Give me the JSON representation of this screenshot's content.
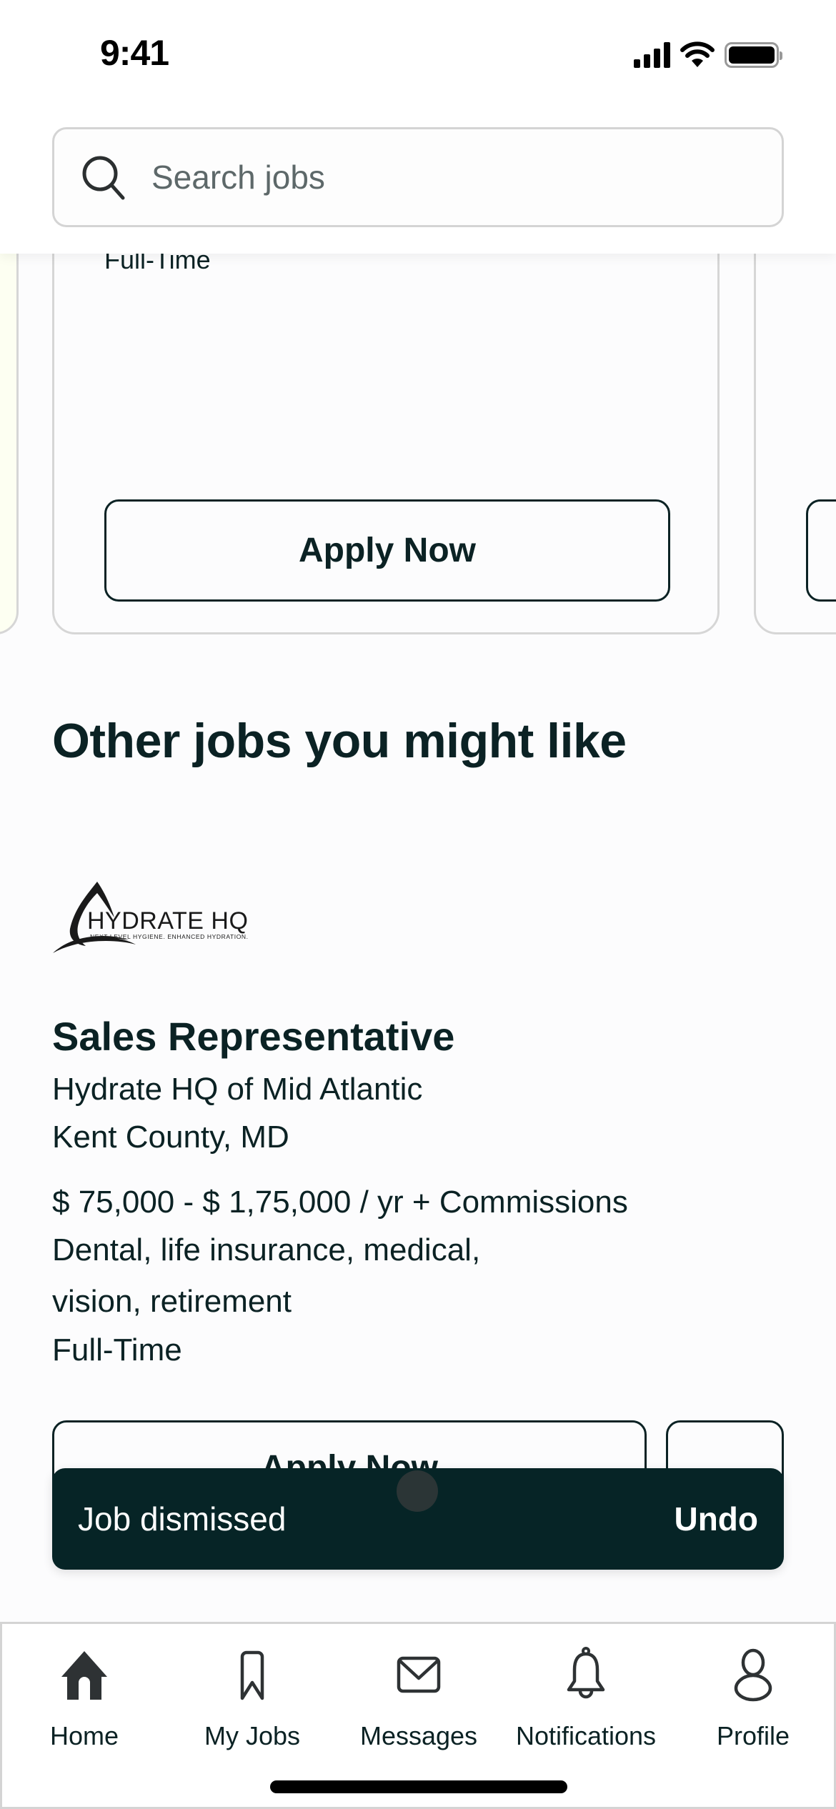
{
  "status_bar": {
    "time": "9:41"
  },
  "search": {
    "placeholder": "Search jobs"
  },
  "carousel": {
    "current_card": {
      "job_type": "Full-Time",
      "apply_label": "Apply Now"
    }
  },
  "section": {
    "title": "Other jobs you might like"
  },
  "job": {
    "company_logo_text": "HYDRATE HQ",
    "company_logo_tagline": "NEXT LEVEL HYGIENE. ENHANCED HYDRATION.",
    "title": "Sales Representative",
    "company": "Hydrate HQ of Mid Atlantic",
    "location": "Kent County, MD",
    "salary": "$ 75,000 - $ 1,75,000 / yr + Commissions",
    "benefits_line1": "Dental, life insurance, medical,",
    "benefits_line2": "vision, retirement",
    "job_type": "Full-Time",
    "apply_label": "Apply Now"
  },
  "toast": {
    "message": "Job dismissed",
    "action": "Undo"
  },
  "tabbar": {
    "items": [
      {
        "label": "Home",
        "icon": "home-icon",
        "active": true
      },
      {
        "label": "My Jobs",
        "icon": "bookmark-icon",
        "active": false
      },
      {
        "label": "Messages",
        "icon": "envelope-icon",
        "active": false
      },
      {
        "label": "Notifications",
        "icon": "bell-icon",
        "active": false
      },
      {
        "label": "Profile",
        "icon": "person-icon",
        "active": false
      }
    ]
  },
  "colors": {
    "primary_text": "#0b2224",
    "toast_bg": "#062426",
    "border": "#d4d4d4",
    "placeholder": "#5d6869"
  }
}
